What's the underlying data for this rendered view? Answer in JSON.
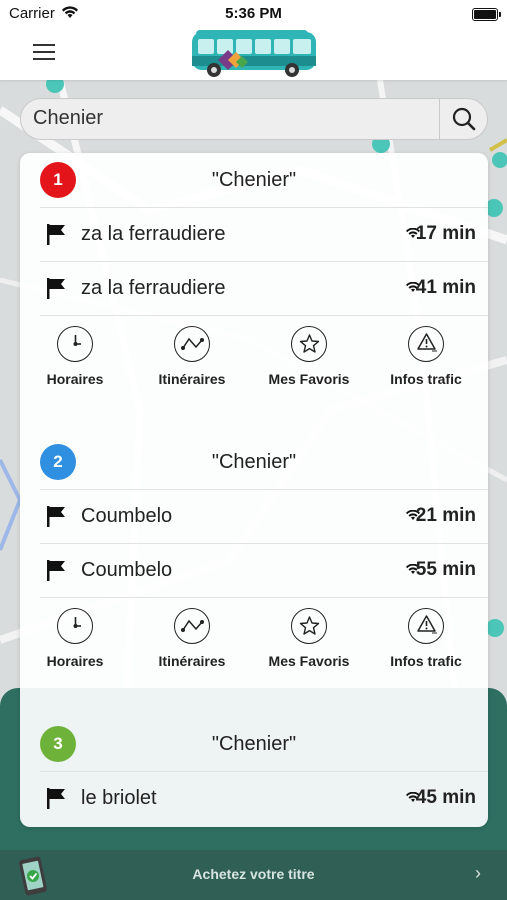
{
  "status_bar": {
    "carrier": "Carrier",
    "time": "5:36 PM"
  },
  "search": {
    "value": "Chenier"
  },
  "stops": [
    {
      "number": "1",
      "color": "#e3151b",
      "name": "\"Chenier\"",
      "departures": [
        {
          "destination": "za la ferraudiere",
          "time": "17 min"
        },
        {
          "destination": "za la ferraudiere",
          "time": "41 min"
        }
      ]
    },
    {
      "number": "2",
      "color": "#2f8fe0",
      "name": "\"Chenier\"",
      "departures": [
        {
          "destination": "Coumbelo",
          "time": "21 min"
        },
        {
          "destination": "Coumbelo",
          "time": "55 min"
        }
      ]
    },
    {
      "number": "3",
      "color": "#6fb23a",
      "name": "\"Chenier\"",
      "departures": [
        {
          "destination": "le briolet",
          "time": "45 min"
        }
      ]
    }
  ],
  "actions": {
    "horaires": "Horaires",
    "itineraires": "Itinéraires",
    "favoris": "Mes Favoris",
    "trafic": "Infos trafic"
  },
  "buy_bar": {
    "label": "Achetez votre titre"
  },
  "colors": {
    "header_bg": "#ffffff",
    "bottom_bar": "#2f5f55",
    "bus_teal": "#2fb5b5"
  },
  "icons": [
    "menu-icon",
    "bus-logo",
    "search-icon",
    "flag-icon",
    "realtime-signal-icon",
    "clock-icon",
    "route-icon",
    "star-icon",
    "traffic-warning-icon",
    "chevron-right-icon",
    "phone-ticket-icon"
  ]
}
